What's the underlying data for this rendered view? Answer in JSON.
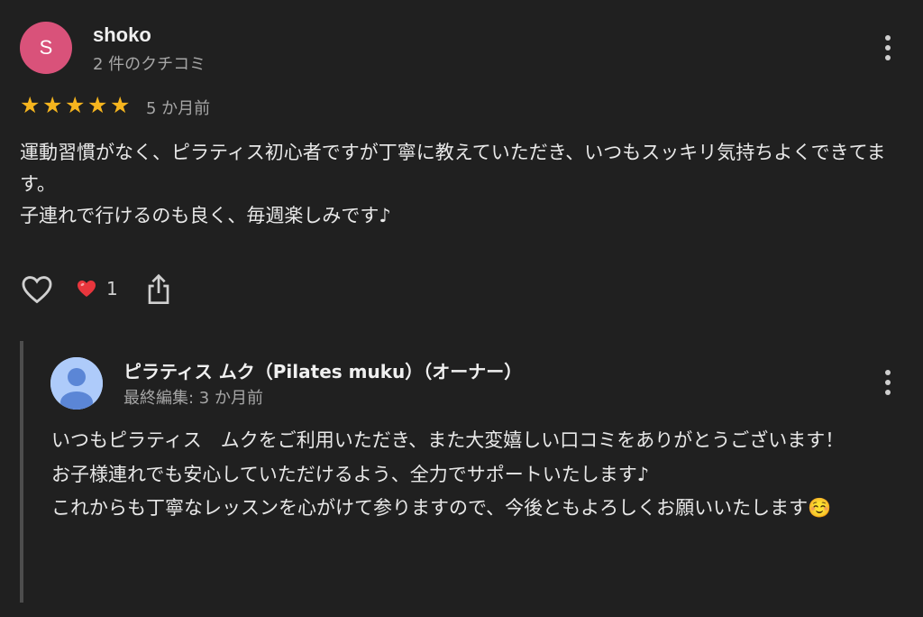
{
  "reviewer": {
    "avatar_initial": "S",
    "avatar_color": "#d9527a",
    "name": "shoko",
    "meta": "2 件のクチコミ"
  },
  "rating": {
    "stars": 5,
    "max_stars": 5,
    "star_color": "#f6b51e",
    "date": "5 か月前"
  },
  "review_text": "運動習慣がなく、ピラティス初心者ですが丁寧に教えていただき、いつもスッキリ気持ちよくできてます。\n子連れで行けるのも良く、毎週楽しみです♪",
  "actions": {
    "like_icon": "heart-outline-icon",
    "reaction_icon": "red-heart-icon",
    "reaction_count": "1",
    "share_icon": "share-icon"
  },
  "reply": {
    "owner_name": "ピラティス ムク（Pilates muku）（オーナー）",
    "meta": "最終編集: 3 か月前",
    "text": "いつもピラティス　ムクをご利用いただき、また大変嬉しい口コミをありがとうございます！\nお子様連れでも安心していただけるよう、全力でサポートいたします♪\nこれからも丁寧なレッスンを心がけて参りますので、今後ともよろしくお願いいたします☺️"
  }
}
